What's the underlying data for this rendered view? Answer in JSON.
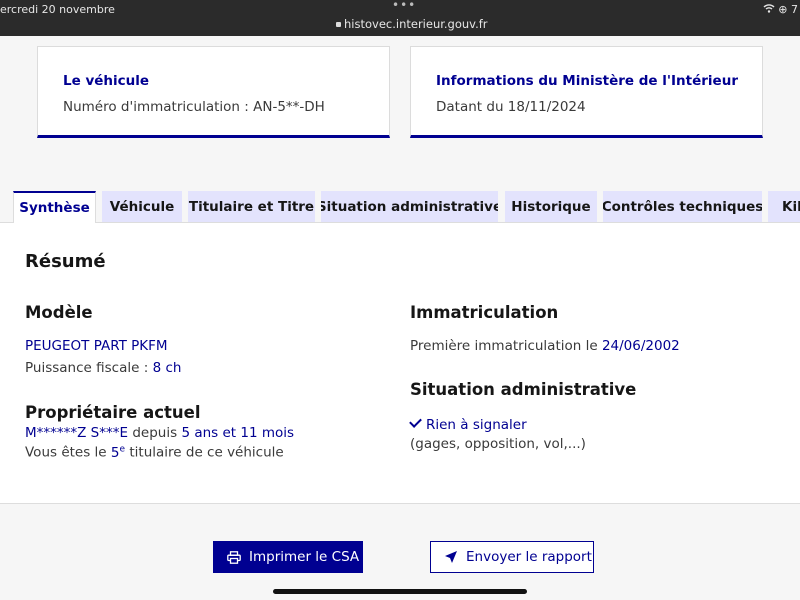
{
  "statusbar": {
    "date": "ercredi 20 novembre",
    "dots": "•••",
    "url": "histovec.interieur.gouv.fr",
    "right": "⊕ 7"
  },
  "cards": {
    "vehicle": {
      "title": "Le véhicule",
      "text": "Numéro d'immatriculation : AN-5**-DH"
    },
    "ministry": {
      "title": "Informations du Ministère de l'Intérieur",
      "text": "Datant du 18/11/2024"
    }
  },
  "tabs": [
    {
      "label": "Synthèse",
      "active": true
    },
    {
      "label": "Véhicule"
    },
    {
      "label": "Titulaire et Titre"
    },
    {
      "label": "Situation administrative"
    },
    {
      "label": "Historique"
    },
    {
      "label": "Contrôles techniques"
    },
    {
      "label": "Kilo"
    }
  ],
  "summary": {
    "title": "Résumé",
    "model": {
      "heading": "Modèle",
      "name": "PEUGEOT PART PKFM",
      "fiscal_label": "Puissance fiscale :",
      "fiscal_value": "8 ch"
    },
    "owner": {
      "heading": "Propriétaire actuel",
      "name": "M******Z S***E",
      "since_label": "depuis",
      "since_value": "5 ans et 11 mois",
      "rank_prefix": "Vous êtes le",
      "rank_number": "5",
      "rank_sup": "e",
      "rank_suffix": "titulaire de ce véhicule"
    },
    "registration": {
      "heading": "Immatriculation",
      "first_label": "Première immatriculation le",
      "first_date": "24/06/2002"
    },
    "admin": {
      "heading": "Situation administrative",
      "status": "Rien à signaler",
      "detail": "(gages, opposition, vol,...)"
    }
  },
  "actions": {
    "print_label": "Imprimer le CSA",
    "send_label": "Envoyer le rapport"
  },
  "colors": {
    "brand": "#000091",
    "tab_bg": "#e3e3fd"
  }
}
